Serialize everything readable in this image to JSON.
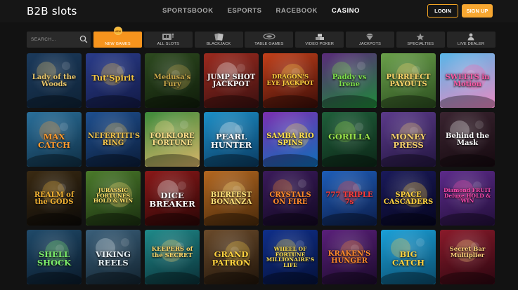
{
  "brand": "B2B slots",
  "nav": [
    {
      "label": "SPORTSBOOK",
      "active": false
    },
    {
      "label": "ESPORTS",
      "active": false
    },
    {
      "label": "RACEBOOK",
      "active": false
    },
    {
      "label": "CASINO",
      "active": true
    }
  ],
  "auth": {
    "login": "LOGIN",
    "signup": "SIGN UP"
  },
  "search": {
    "placeholder": "SEARCH..."
  },
  "categories": [
    {
      "label": "NEW GAMES",
      "icon": "new-badge-icon",
      "active": true
    },
    {
      "label": "ALL SLOTS",
      "icon": "slot-machine-icon",
      "active": false
    },
    {
      "label": "BLACKJACK",
      "icon": "cards-icon",
      "active": false
    },
    {
      "label": "TABLE GAMES",
      "icon": "table-icon",
      "active": false
    },
    {
      "label": "VIDEO POKER",
      "icon": "chips-icon",
      "active": false
    },
    {
      "label": "JACKPOTS",
      "icon": "diamond-icon",
      "active": false
    },
    {
      "label": "SPECIALTIES",
      "icon": "star-icon",
      "active": false
    },
    {
      "label": "LIVE DEALER",
      "icon": "dealer-icon",
      "active": false
    }
  ],
  "games": [
    {
      "title": "Lady of the Woods",
      "bg": [
        "#1b3a5c",
        "#0e2236"
      ],
      "accent": "#e9c76b"
    },
    {
      "title": "Tut'Spirit",
      "bg": [
        "#2a3c8a",
        "#121a46"
      ],
      "accent": "#f4c542"
    },
    {
      "title": "Medusa's Fury",
      "bg": [
        "#2d4a1f",
        "#0f1c0a"
      ],
      "accent": "#c9a84a"
    },
    {
      "title": "JUMP SHOT JACKPOT",
      "bg": [
        "#9c2a1e",
        "#3a1010"
      ],
      "accent": "#ffffff"
    },
    {
      "title": "DRAGON'S EYE JACKPOT",
      "bg": [
        "#c2401a",
        "#3b0d08"
      ],
      "accent": "#ffd23f"
    },
    {
      "title": "Paddy vs Irene",
      "bg": [
        "#5a2a7a",
        "#1f8a3a"
      ],
      "accent": "#7ee04b"
    },
    {
      "title": "PURRFECT PAYOUTS",
      "bg": [
        "#6aa04a",
        "#2b4d1f"
      ],
      "accent": "#ffd76a"
    },
    {
      "title": "SWEETS in Motion",
      "bg": [
        "#58b6e8",
        "#e98ac2"
      ],
      "accent": "#ff5aa8"
    },
    {
      "title": "MAX CATCH",
      "bg": [
        "#2a6f9a",
        "#0f2f45"
      ],
      "accent": "#ff9b2f"
    },
    {
      "title": "NEFERTITI'S RING",
      "bg": [
        "#1e4f8f",
        "#0b1d3a"
      ],
      "accent": "#f0c24b"
    },
    {
      "title": "FOLKLORE FORTUNE",
      "bg": [
        "#3c8a3a",
        "#d8b56a"
      ],
      "accent": "#ffe08a"
    },
    {
      "title": "PEARL HUNTER",
      "bg": [
        "#1c8fc7",
        "#0a3b62"
      ],
      "accent": "#ffffff"
    },
    {
      "title": "SAMBA RIO SPINS",
      "bg": [
        "#7b2fb0",
        "#0f6fb8"
      ],
      "accent": "#ffe14d"
    },
    {
      "title": "GORILLA",
      "bg": [
        "#1f5f3a",
        "#0c2617"
      ],
      "accent": "#9be44a"
    },
    {
      "title": "MONEY PRESS",
      "bg": [
        "#5b3a8a",
        "#231640"
      ],
      "accent": "#f5d06b"
    },
    {
      "title": "Behind the Mask",
      "bg": [
        "#3a2430",
        "#15090f"
      ],
      "accent": "#ffffff"
    },
    {
      "title": "REALM of the GODS",
      "bg": [
        "#3a2a12",
        "#0c0a08"
      ],
      "accent": "#f2b233"
    },
    {
      "title": "JURASSIC FORTUNES HOLD & WIN",
      "bg": [
        "#4a7a2a",
        "#1a2f10"
      ],
      "accent": "#ffe06a"
    },
    {
      "title": "DICE BREAKER",
      "bg": [
        "#8a1818",
        "#2a0606"
      ],
      "accent": "#ffffff"
    },
    {
      "title": "BIERFEST BONANZA",
      "bg": [
        "#b3671f",
        "#4a2a0b"
      ],
      "accent": "#ffe27a"
    },
    {
      "title": "CRYSTALS ON FIRE",
      "bg": [
        "#3a1a5a",
        "#120822"
      ],
      "accent": "#ff8a2a"
    },
    {
      "title": "777 TRIPLE 7s",
      "bg": [
        "#1d5db8",
        "#0c1d4a"
      ],
      "accent": "#ff3b3b"
    },
    {
      "title": "SPACE CASCADERS",
      "bg": [
        "#1a1a5a",
        "#05051f"
      ],
      "accent": "#ffd23f"
    },
    {
      "title": "Diamond FRUIT Deluxe HOLD & WIN",
      "bg": [
        "#5c2a8a",
        "#220f3a"
      ],
      "accent": "#ff4ab0"
    },
    {
      "title": "SHELL SHOCK",
      "bg": [
        "#1f4a6a",
        "#0a1a2a"
      ],
      "accent": "#7ef06b"
    },
    {
      "title": "VIKING REELS",
      "bg": [
        "#3a5f7a",
        "#12232f"
      ],
      "accent": "#e6f0f5"
    },
    {
      "title": "KEEPERS of the SECRET",
      "bg": [
        "#1f8a8a",
        "#0a2f36"
      ],
      "accent": "#ffd86a"
    },
    {
      "title": "GRAND PATRON",
      "bg": [
        "#6a4a2a",
        "#1f140a"
      ],
      "accent": "#ffd23f"
    },
    {
      "title": "WHEEL OF FORTUNE MILLIONAIRE'S LIFE",
      "bg": [
        "#0f2f8a",
        "#05113a"
      ],
      "accent": "#ffe14d"
    },
    {
      "title": "KRAKEN'S HUNGER",
      "bg": [
        "#5a1f7a",
        "#1a0a2a"
      ],
      "accent": "#ff8a2a"
    },
    {
      "title": "BIG CATCH",
      "bg": [
        "#1aa0d8",
        "#0a4a6a"
      ],
      "accent": "#ffd23f"
    },
    {
      "title": "Secret Bar Multiplier",
      "bg": [
        "#8a1a2a",
        "#2a0610"
      ],
      "accent": "#ffd27a"
    }
  ]
}
